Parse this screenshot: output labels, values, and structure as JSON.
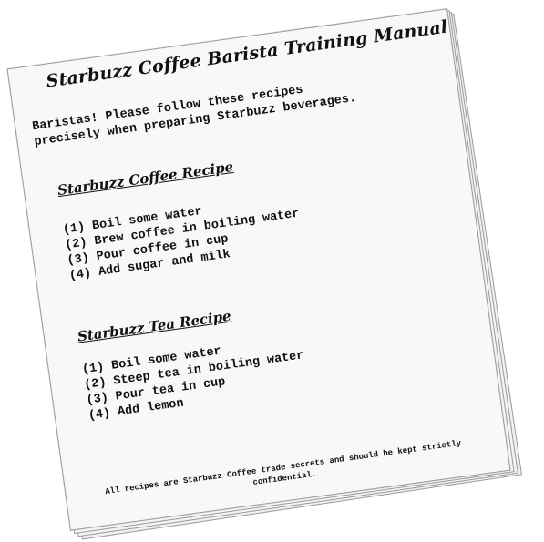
{
  "manual": {
    "title": "Starbuzz Coffee Barista Training Manual",
    "intro": "Baristas!  Please follow these recipes\nprecisely when preparing Starbuzz beverages.",
    "coffee": {
      "heading": "Starbuzz Coffee Recipe",
      "steps": [
        "(1) Boil some water",
        "(2) Brew coffee in boiling water",
        "(3) Pour coffee in cup",
        "(4) Add sugar and milk"
      ]
    },
    "tea": {
      "heading": "Starbuzz Tea Recipe",
      "steps": [
        "(1) Boil some water",
        "(2) Steep tea in boiling water",
        "(3) Pour tea in cup",
        "(4) Add lemon"
      ]
    },
    "footer": "All recipes are Starbuzz Coffee trade secrets and should be kept strictly confidential."
  }
}
